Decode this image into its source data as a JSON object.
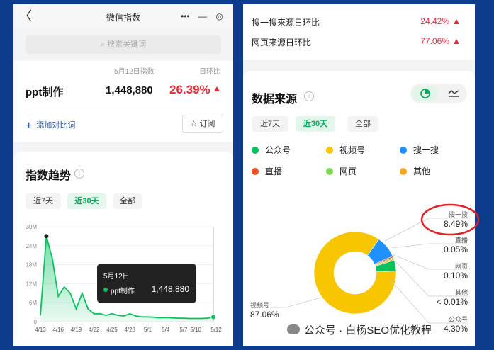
{
  "left": {
    "title": "微信指数",
    "back": "〈",
    "capsule_more": "•••",
    "capsule_min": "—",
    "capsule_close": "◎",
    "search_placeholder": "⌕ 搜索关键词",
    "header_date": "5月12日指数",
    "header_rate": "日环比",
    "keyword": "ppt制作",
    "index_value": "1,448,880",
    "rate": "26.39%",
    "add_compare": "添加对比词",
    "add_icon": "+",
    "subscribe": "☆ 订阅",
    "trend_title": "指数趋势",
    "info": "i",
    "ranges": [
      "近7天",
      "近30天",
      "全部"
    ],
    "active_range": 1,
    "tooltip": {
      "date": "5月12日",
      "name": "ppt制作",
      "value": "1,448,880"
    }
  },
  "chart_data": {
    "type": "area",
    "title": "指数趋势",
    "x_ticks": [
      "4/13",
      "4/16",
      "4/19",
      "4/22",
      "4/25",
      "4/28",
      "5/1",
      "5/4",
      "5/7",
      "5/10",
      "5/12"
    ],
    "y_ticks": [
      "30M",
      "24M",
      "18M",
      "12M",
      "6M",
      "0"
    ],
    "ylim": [
      0,
      30000000
    ],
    "series": [
      {
        "color": "#07c160",
        "points": [
          [
            "4/13",
            2000000
          ],
          [
            "4/14",
            27000000
          ],
          [
            "4/15",
            20000000
          ],
          [
            "4/16",
            8000000
          ],
          [
            "4/17",
            11000000
          ],
          [
            "4/18",
            9000000
          ],
          [
            "4/19",
            4000000
          ],
          [
            "4/20",
            9000000
          ],
          [
            "4/21",
            4000000
          ],
          [
            "4/22",
            2500000
          ],
          [
            "4/23",
            2500000
          ],
          [
            "4/24",
            2000000
          ],
          [
            "4/25",
            2500000
          ],
          [
            "4/26",
            2000000
          ],
          [
            "4/27",
            1800000
          ],
          [
            "4/28",
            2500000
          ],
          [
            "4/29",
            1800000
          ],
          [
            "4/30",
            1500000
          ],
          [
            "5/1",
            1500000
          ],
          [
            "5/2",
            1400000
          ],
          [
            "5/3",
            1200000
          ],
          [
            "5/4",
            1300000
          ],
          [
            "5/5",
            1200000
          ],
          [
            "5/6",
            1100000
          ],
          [
            "5/7",
            1100000
          ],
          [
            "5/8",
            1000000
          ],
          [
            "5/9",
            1000000
          ],
          [
            "5/10",
            1000000
          ],
          [
            "5/11",
            1100000
          ],
          [
            "5/12",
            1448880
          ]
        ]
      }
    ],
    "peak_marker": "4/14",
    "selected_point": "5/12"
  },
  "right": {
    "rows": [
      {
        "label": "搜一搜来源日环比",
        "value": "24.42%"
      },
      {
        "label": "网页来源日环比",
        "value": "77.06%"
      }
    ],
    "source_title": "数据来源",
    "info": "i",
    "ranges": [
      "近7天",
      "近30天",
      "全部"
    ],
    "active_range": 1,
    "legend": [
      {
        "name": "公众号",
        "color": "#07c160"
      },
      {
        "name": "视频号",
        "color": "#f7c600"
      },
      {
        "name": "搜一搜",
        "color": "#1e90ff"
      },
      {
        "name": "直播",
        "color": "#f04e23"
      },
      {
        "name": "网页",
        "color": "#7ed957"
      },
      {
        "name": "其他",
        "color": "#f5a623"
      }
    ],
    "pie": {
      "type": "pie",
      "slices": [
        {
          "name": "视频号",
          "value": 87.06,
          "label": "87.06%",
          "color": "#f7c600"
        },
        {
          "name": "搜一搜",
          "value": 8.49,
          "label": "8.49%",
          "color": "#1e90ff"
        },
        {
          "name": "直播",
          "value": 0.05,
          "label": "0.05%",
          "color": "#f04e23"
        },
        {
          "name": "网页",
          "value": 0.1,
          "label": "0.10%",
          "color": "#7ed957"
        },
        {
          "name": "其他",
          "value": 0.01,
          "label": "< 0.01%",
          "color": "#f5a623"
        },
        {
          "name": "公众号",
          "value": 4.3,
          "label": "4.30%",
          "color": "#07c160"
        }
      ]
    }
  },
  "watermark": "公众号 · 白杨SEO优化教程"
}
